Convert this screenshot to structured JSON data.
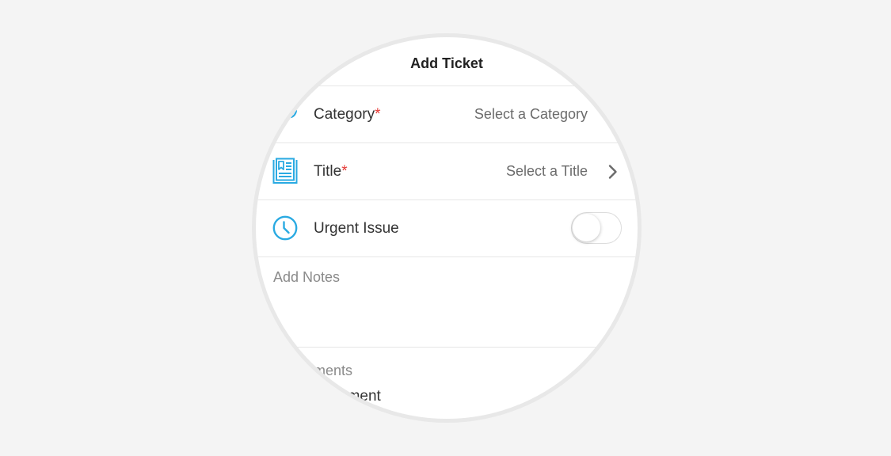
{
  "header": {
    "title": "Add Ticket"
  },
  "form": {
    "category": {
      "label": "Category",
      "required_mark": "*",
      "value": "Select a Category"
    },
    "title": {
      "label": "Title",
      "required_mark": "*",
      "value": "Select a Title"
    },
    "urgent": {
      "label": "Urgent Issue",
      "on": false
    },
    "notes": {
      "placeholder": "Add Notes"
    },
    "attachments": {
      "section_label": "ments",
      "item_label": "hment"
    }
  },
  "icons": {
    "category": "tag-icon",
    "title": "document-icon",
    "urgent": "clock-icon",
    "chevron": "chevron-right-icon"
  },
  "colors": {
    "accent": "#2aaae2",
    "required": "#e53935",
    "background": "#f4f4f4"
  }
}
